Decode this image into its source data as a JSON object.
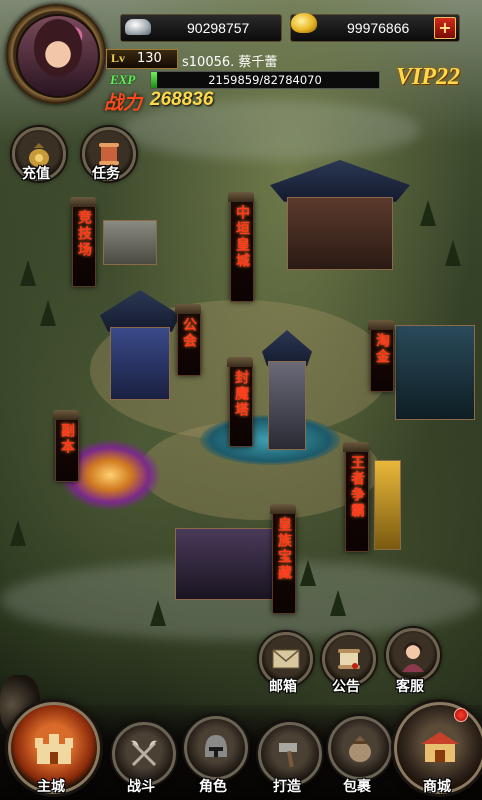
{
  "resources": {
    "silver": "90298757",
    "gold": "99976866",
    "add_symbol": "+"
  },
  "player": {
    "level_label": "Lv",
    "level": "130",
    "name": "s10056. 蔡千蕾",
    "exp_label": "EXP",
    "exp_current": 2159859,
    "exp_max": 82784070,
    "exp_text": "2159859/82784070",
    "power_label": "战力",
    "power": "268836",
    "vip": "VIP22"
  },
  "quick_buttons": {
    "recharge": "充值",
    "tasks": "任务"
  },
  "map_locations": {
    "arena": "竞技场",
    "imperial_city": "中垣皇城",
    "guild": "公会",
    "tower": "封魔塔",
    "gold_rush": "淘金",
    "dungeon": "副本",
    "king_fight": "王者争霸",
    "treasure": "皇族宝藏"
  },
  "side_menu": {
    "mail": "邮箱",
    "notice": "公告",
    "service": "客服"
  },
  "bottom_nav": {
    "main_city": "主城",
    "battle": "战斗",
    "character": "角色",
    "forge": "打造",
    "bag": "包裹",
    "shop": "商城"
  }
}
